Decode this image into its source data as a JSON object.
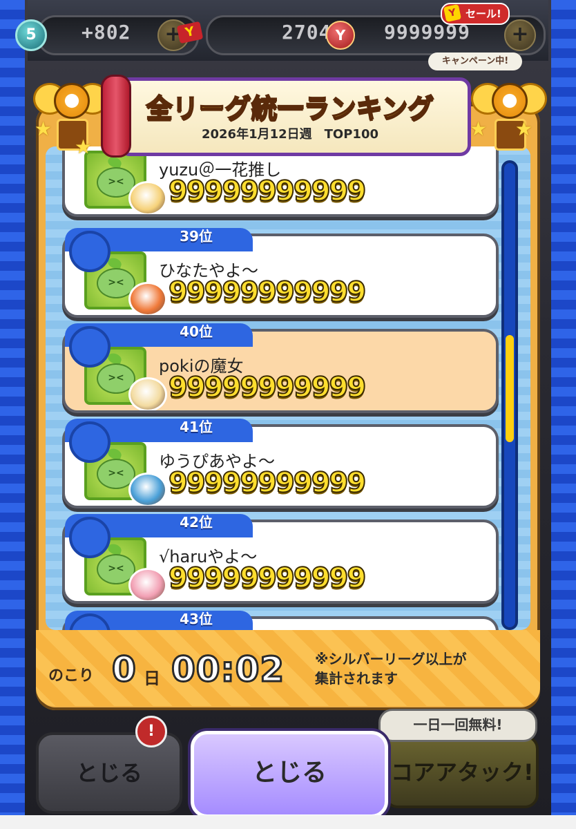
{
  "header": {
    "stamina_level": "5",
    "stamina_value": "+802",
    "tickets": "2704",
    "coins": "9999999",
    "sale_label": "セール!",
    "campaign_label": "キャンペーン中!"
  },
  "banner": {
    "title": "全リーグ統一ランキング",
    "subtitle": "2026年1月12日週　TOP100"
  },
  "ranking": [
    {
      "rank": "",
      "name": "yuzu＠一花推し",
      "score": "99999999999",
      "chara_color": "#f6d27a"
    },
    {
      "rank": "39位",
      "name": "ひなたやよ～",
      "score": "99999999999",
      "chara_color": "#f07a3a"
    },
    {
      "rank": "40位",
      "name": "pokiの魔女",
      "score": "99999999999",
      "chara_color": "#f3dba0",
      "highlight": true
    },
    {
      "rank": "41位",
      "name": "ゆうぴあやよ～",
      "score": "99999999999",
      "chara_color": "#4aa0d8"
    },
    {
      "rank": "42位",
      "name": "√haruやよ～",
      "score": "99999999999",
      "chara_color": "#f2a0b4"
    },
    {
      "rank": "43位",
      "name": "",
      "score": "",
      "chara_color": "#ffffff"
    }
  ],
  "scroll": {
    "position_fraction": 0.37,
    "visible_fraction": 0.23
  },
  "footer": {
    "remaining_label": "のこり",
    "days": "0",
    "day_unit": "日",
    "time": "00:02",
    "note_line1": "※シルバーリーグ以上が",
    "note_line2": "集計されます"
  },
  "bottom": {
    "left_button": "とじる",
    "close_button": "とじる",
    "attack_button": "コアアタック!",
    "free_bubble": "一日一回無料!",
    "notification_count": "!"
  },
  "colors": {
    "panel": "#f0b046",
    "rank_tab": "#2e66e1",
    "score": "#ffde2e",
    "highlight_row": "#fcd8a8"
  }
}
